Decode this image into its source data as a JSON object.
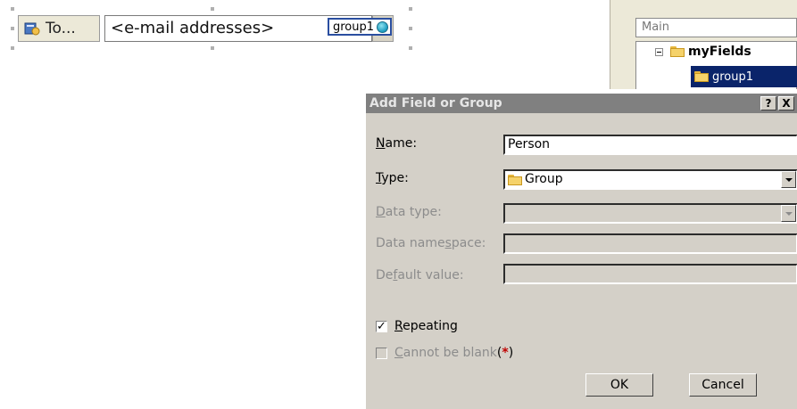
{
  "form": {
    "to_button_label": "To...",
    "email_placeholder": "<e-mail addresses>",
    "group_tag": "group1"
  },
  "task_pane": {
    "data_source": "Main",
    "tree": {
      "root": "myFields",
      "selected_child": "group1"
    }
  },
  "dialog": {
    "title": "Add Field or Group",
    "help_button": "?",
    "close_button": "X",
    "name_label": "Name:",
    "name_value": "Person",
    "type_label": "Type:",
    "type_value": "Group",
    "data_type_label": "Data type:",
    "data_namespace_label": "Data namespace:",
    "default_value_label": "Default value:",
    "repeating_label": "Repeating",
    "repeating_checked": true,
    "cannot_be_blank_label": "Cannot be blank",
    "required_marker_open": "(",
    "required_marker_star": "*",
    "required_marker_close": ")",
    "cannot_be_blank_checked": false,
    "ok_label": "OK",
    "cancel_label": "Cancel"
  }
}
